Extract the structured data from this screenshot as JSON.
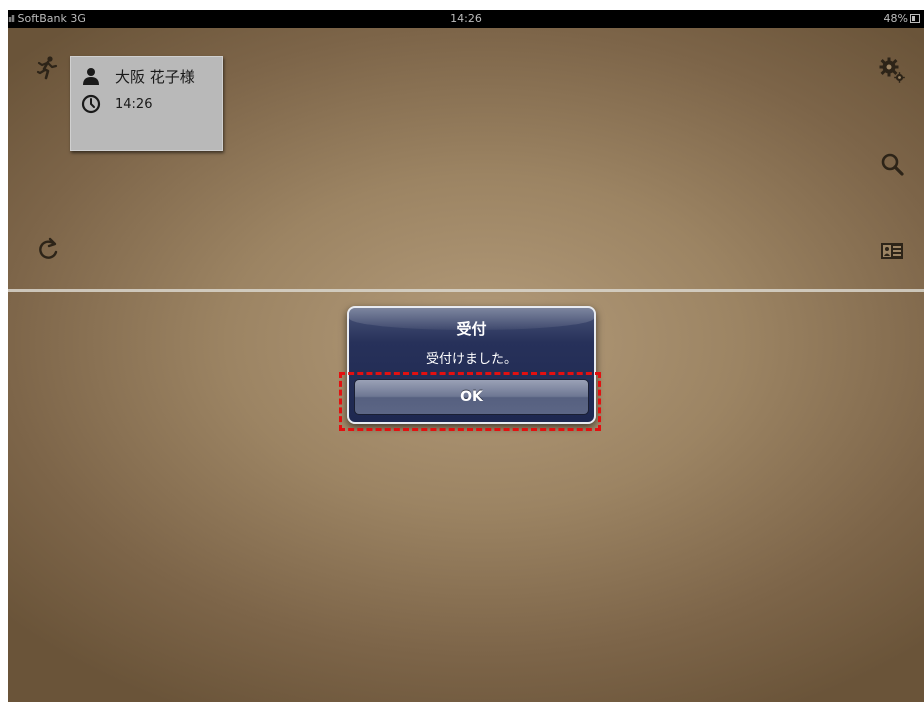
{
  "status_bar": {
    "carrier": "SoftBank",
    "network": "3G",
    "signal_bars": "ııll",
    "time": "14:26",
    "battery": "48%"
  },
  "sidebar_left": {
    "runner_icon": "runner-icon",
    "refresh_icon": "refresh-icon"
  },
  "sidebar_right": {
    "settings_icon": "gear-icon",
    "search_icon": "search-icon",
    "card_icon": "id-card-icon"
  },
  "visitor_card": {
    "name": "大阪 花子様",
    "time": "14:26"
  },
  "alert": {
    "title": "受付",
    "message": "受付けました。",
    "ok_label": "OK"
  },
  "colors": {
    "highlight": "#e31010",
    "alert_bg": "#27315a",
    "background": "#9c8463"
  }
}
